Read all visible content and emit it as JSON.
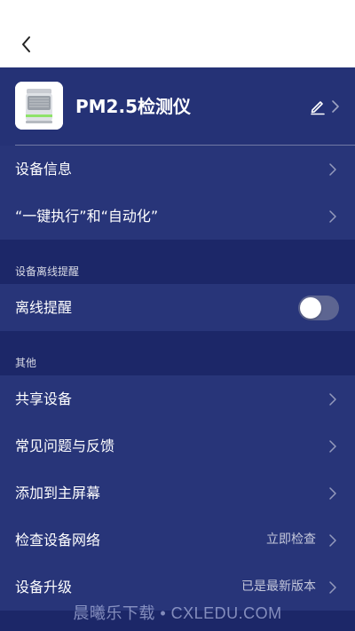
{
  "device": {
    "name": "PM2.5检测仪"
  },
  "rows_top": [
    {
      "label": "设备信息"
    },
    {
      "label": "“一键执行”和“自动化”"
    }
  ],
  "section_offline": {
    "title": "设备离线提醒",
    "row_label": "离线提醒",
    "toggle_on": false
  },
  "section_other": {
    "title": "其他",
    "rows": [
      {
        "label": "共享设备",
        "trail": ""
      },
      {
        "label": "常见问题与反馈",
        "trail": ""
      },
      {
        "label": "添加到主屏幕",
        "trail": ""
      },
      {
        "label": "检查设备网络",
        "trail": "立即检查"
      },
      {
        "label": "设备升级",
        "trail": "已是最新版本"
      }
    ]
  },
  "watermark": "晨曦乐下载 • CXLEDU.COM",
  "icons": {
    "back": "chevron-left-icon",
    "edit": "pencil-icon",
    "row_arrow": "chevron-right-icon"
  },
  "colors": {
    "background": "#253276",
    "row": "#283579",
    "section": "#1c2768",
    "toggle_off": "#5d6591"
  }
}
